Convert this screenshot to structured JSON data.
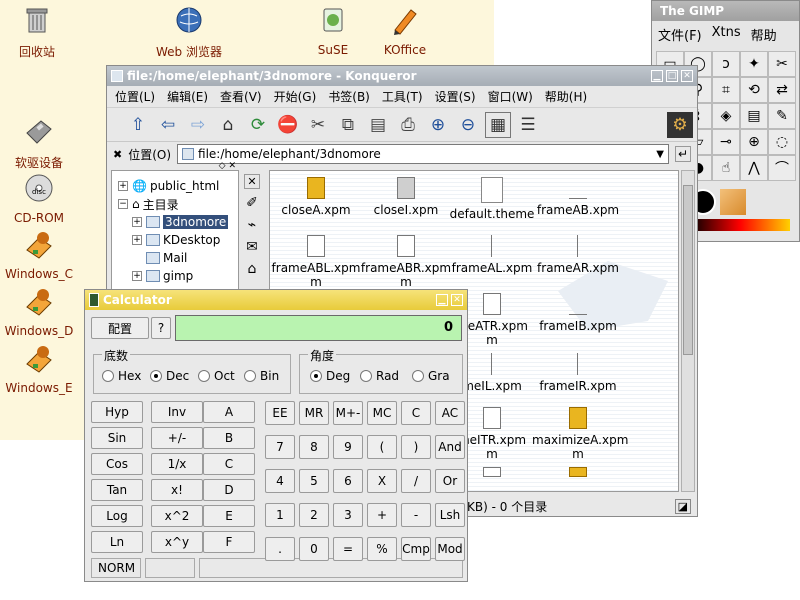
{
  "desktop": {
    "icons": [
      {
        "label": "回收站"
      },
      {
        "label": "Web 浏览器"
      },
      {
        "label": "SuSE"
      },
      {
        "label": "KOffice"
      },
      {
        "label": "软驱设备"
      },
      {
        "label": "CD-ROM"
      },
      {
        "label": "Windows_C"
      },
      {
        "label": "Windows_D"
      },
      {
        "label": "Windows_E"
      }
    ]
  },
  "gimp": {
    "title": "The GIMP",
    "menu": [
      "文件(F)",
      "Xtns",
      "帮助"
    ]
  },
  "konqueror": {
    "title": "file:/home/elephant/3dnomore - Konqueror",
    "menu": [
      "位置(L)",
      "编辑(E)",
      "查看(V)",
      "开始(G)",
      "书签(B)",
      "工具(T)",
      "设置(S)",
      "窗口(W)",
      "帮助(H)"
    ],
    "location_label": "位置(O)",
    "location_value": "file:/home/elephant/3dnomore",
    "tree": [
      {
        "label": "public_html"
      },
      {
        "label": "主目录"
      },
      {
        "label": "3dnomore"
      },
      {
        "label": "KDesktop"
      },
      {
        "label": "Mail"
      },
      {
        "label": "gimp"
      }
    ],
    "files": [
      "closeA.xpm",
      "closeI.xpm",
      "default.theme",
      "frameAB.xpm",
      "frameABL.xpm",
      "frameABR.xpm",
      "frameAL.xpm",
      "frameAR.xpm",
      "meATR.xpm",
      "frameIB.xpm",
      "meIL.xpm",
      "frameIR.xpm",
      "meITR.xpm",
      "maximizeA.xpm"
    ],
    "file_line2": {
      "frameABL.xpm": "m",
      "frameABR.xpm": "m",
      "meATR.xpm": "m",
      "meITR.xpm": "m",
      "maximizeA.xpm": "m"
    },
    "status": "KB) - 0 个目录"
  },
  "calculator": {
    "title": "Calculator",
    "config_label": "配置",
    "help_label": "?",
    "display_value": "0",
    "base_group": "底数",
    "base_options": [
      "Hex",
      "Dec",
      "Oct",
      "Bin"
    ],
    "base_selected": "Dec",
    "angle_group": "角度",
    "angle_options": [
      "Deg",
      "Rad",
      "Gra"
    ],
    "angle_selected": "Deg",
    "sci_buttons": [
      [
        "Hyp",
        "Inv",
        "A"
      ],
      [
        "Sin",
        "+/-",
        "B"
      ],
      [
        "Cos",
        "1/x",
        "C"
      ],
      [
        "Tan",
        "x!",
        "D"
      ],
      [
        "Log",
        "x^2",
        "E"
      ],
      [
        "Ln",
        "x^y",
        "F"
      ]
    ],
    "num_buttons": [
      [
        "EE",
        "MR",
        "M+-",
        "MC",
        "C",
        "AC"
      ],
      [
        "7",
        "8",
        "9",
        "(",
        ")",
        "And"
      ],
      [
        "4",
        "5",
        "6",
        "X",
        "/",
        "Or"
      ],
      [
        "1",
        "2",
        "3",
        "+",
        "-",
        "Lsh"
      ],
      [
        ".",
        "0",
        "=",
        "%",
        "Cmp",
        "Mod"
      ]
    ],
    "status_mode": "NORM"
  },
  "colors": {
    "konq_title": "#a6adb5",
    "calc_title": "#e8cb3a",
    "display_bg": "#b9f3b0",
    "desktop_bg": "#fdf7dc"
  }
}
